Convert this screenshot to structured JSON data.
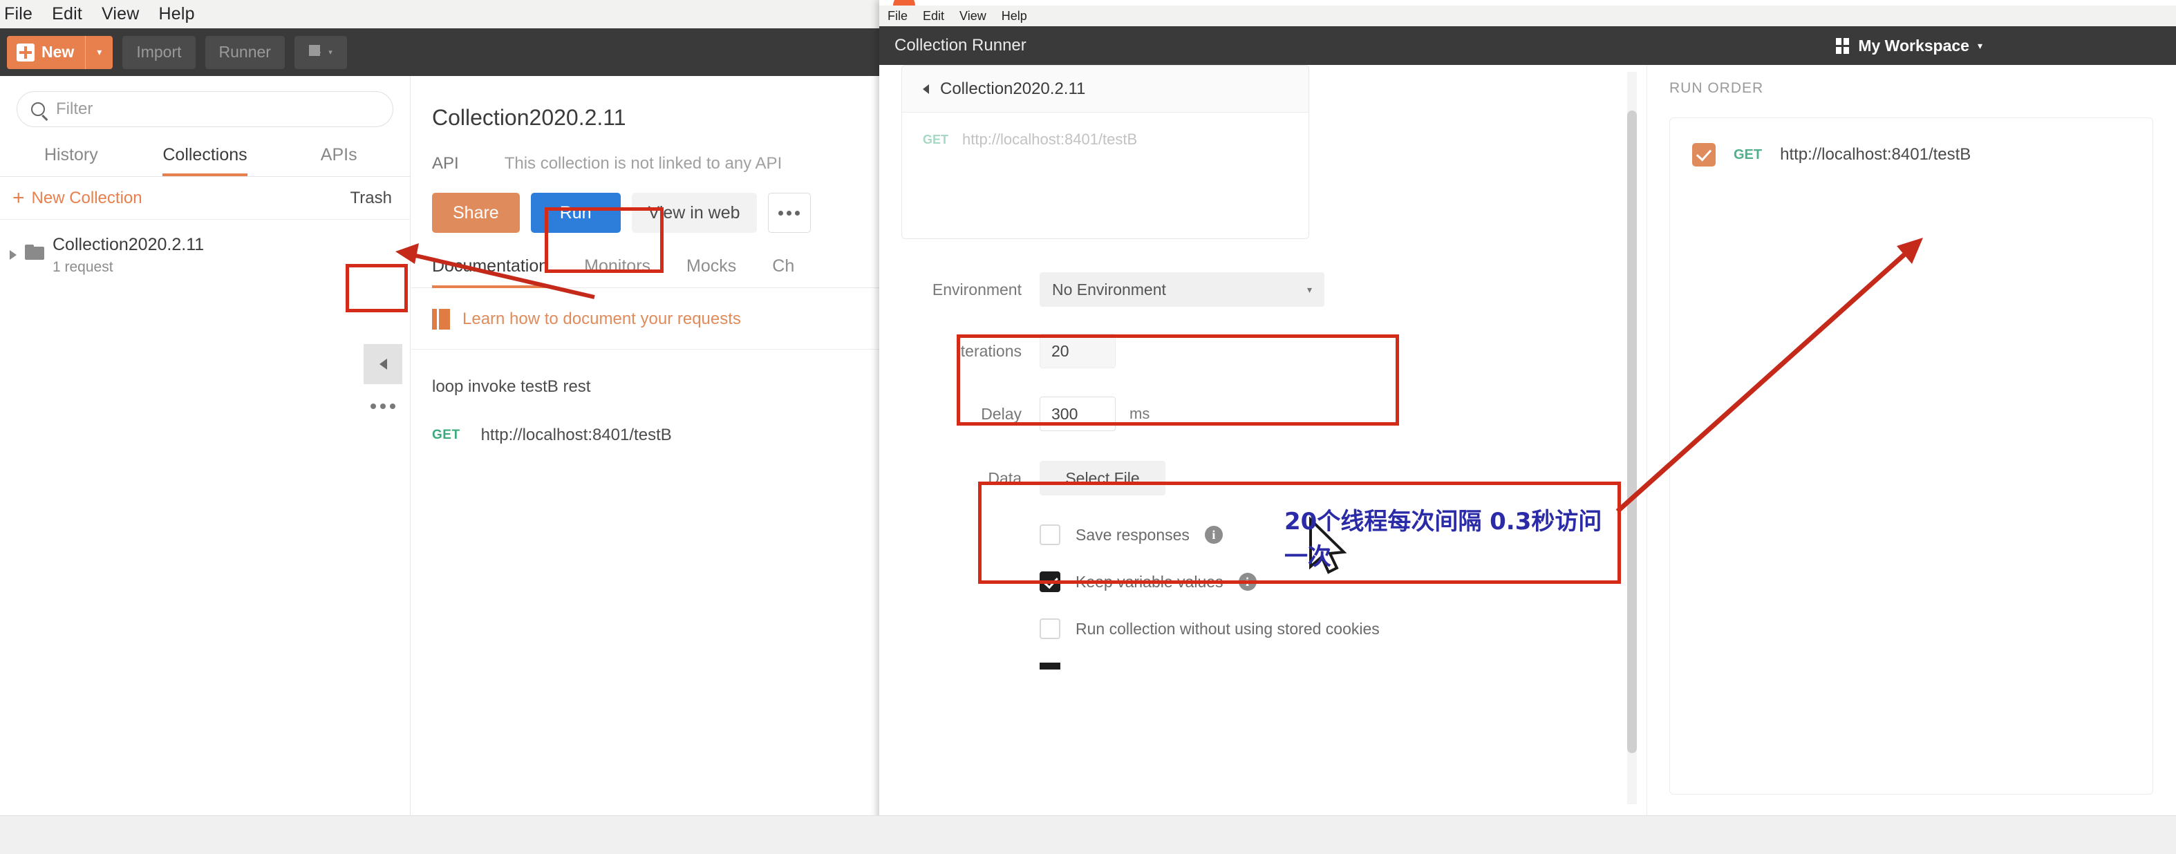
{
  "background_window": {
    "menubar": [
      "File",
      "Edit",
      "View",
      "Help"
    ],
    "toolbar": {
      "new_label": "New",
      "new_caret": "▾",
      "import_label": "Import",
      "runner_label": "Runner",
      "new_window_caret": "▾"
    },
    "sidebar": {
      "filter_placeholder": "Filter",
      "tabs": [
        {
          "label": "History",
          "active": false
        },
        {
          "label": "Collections",
          "active": true
        },
        {
          "label": "APIs",
          "active": false
        }
      ],
      "new_collection_label": "New Collection",
      "new_collection_plus": "+",
      "trash_label": "Trash",
      "collection": {
        "name": "Collection2020.2.11",
        "meta": "1 request"
      }
    },
    "main": {
      "title": "Collection2020.2.11",
      "api_label": "API",
      "api_value": "This collection is not linked to any API",
      "buttons": {
        "share": "Share",
        "run": "Run",
        "view_in_web": "View in web"
      },
      "tabs": [
        {
          "label": "Documentation",
          "active": true
        },
        {
          "label": "Monitors",
          "active": false
        },
        {
          "label": "Mocks",
          "active": false
        },
        {
          "label": "Ch",
          "active": false
        }
      ],
      "doc_hint_link": "Learn how to document your requests",
      "doc_description": "loop invoke testB rest",
      "request": {
        "method": "GET",
        "url": "http://localhost:8401/testB"
      }
    }
  },
  "runner_window": {
    "menubar": [
      "File",
      "Edit",
      "View",
      "Help"
    ],
    "title": "Collection Runner",
    "workspace": {
      "label": "My Workspace",
      "caret": "▾"
    },
    "selected_collection": {
      "name": "Collection2020.2.11",
      "request": {
        "method": "GET",
        "url": "http://localhost:8401/testB"
      }
    },
    "form": {
      "environment_label": "Environment",
      "environment_value": "No Environment",
      "environment_caret": "▾",
      "iterations_label": "Iterations",
      "iterations_value": "20",
      "delay_label": "Delay",
      "delay_value": "300",
      "delay_unit": "ms",
      "data_label": "Data",
      "select_file_label": "Select File",
      "checkboxes": [
        {
          "label": "Save responses",
          "checked": false,
          "info": "i"
        },
        {
          "label": "Keep variable values",
          "checked": true,
          "info": "i"
        },
        {
          "label": "Run collection without using stored cookies",
          "checked": false,
          "info": ""
        }
      ]
    },
    "run_order": {
      "title": "RUN ORDER",
      "items": [
        {
          "checked": true,
          "method": "GET",
          "url": "http://localhost:8401/testB"
        }
      ]
    }
  },
  "annotations": {
    "chinese_note_line1": "20个线程每次间隔 0.3秒访问",
    "chinese_note_line2": "一次",
    "highlight_color": "#d42b18",
    "note_color": "#2b2ba8"
  }
}
